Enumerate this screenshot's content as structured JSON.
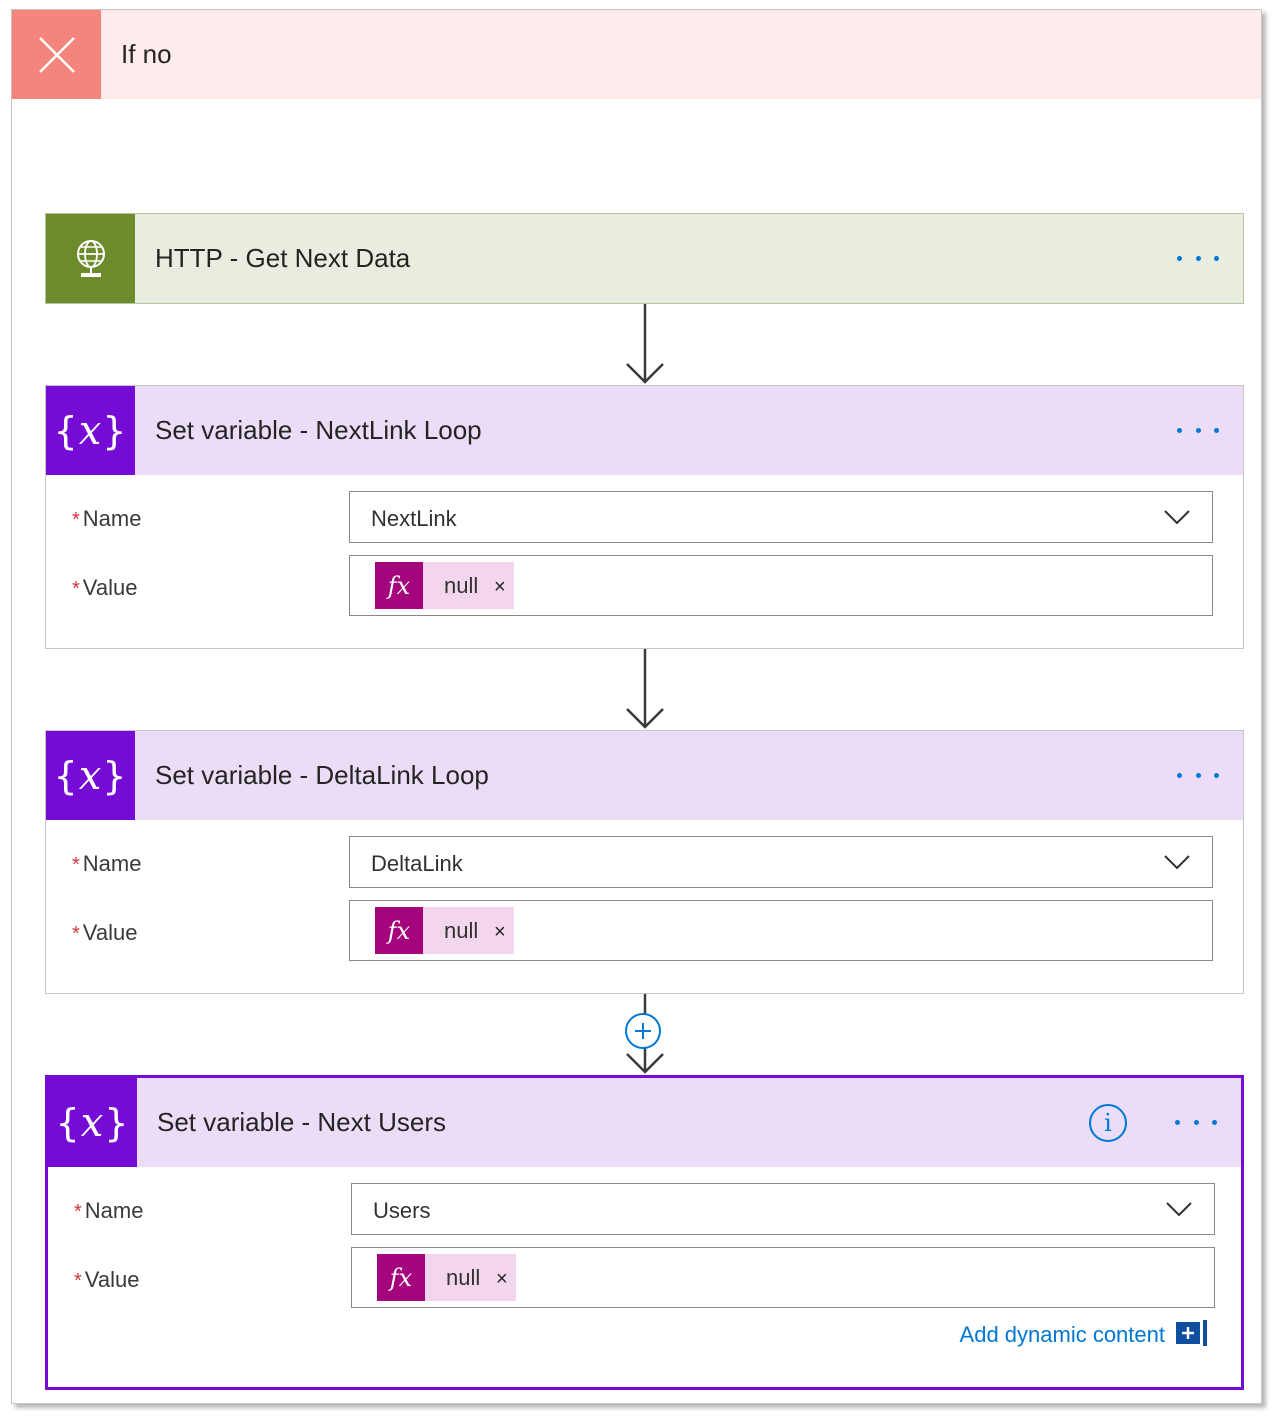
{
  "branch": {
    "title": "If no",
    "icon": "close-icon",
    "color": "#f4857c"
  },
  "actions": [
    {
      "title": "HTTP - Get Next Data",
      "icon": "http-globe-icon",
      "color": "#6d8b2d"
    },
    {
      "title": "Set variable - NextLink Loop",
      "icon": "variable-icon",
      "color": "#770bd6",
      "name_label": "Name",
      "name_value": "NextLink",
      "value_label": "Value",
      "value_token": "null"
    },
    {
      "title": "Set variable - DeltaLink Loop",
      "icon": "variable-icon",
      "color": "#770bd6",
      "name_label": "Name",
      "name_value": "DeltaLink",
      "value_label": "Value",
      "value_token": "null"
    },
    {
      "title": "Set variable - Next Users",
      "icon": "variable-icon",
      "color": "#770bd6",
      "name_label": "Name",
      "name_value": "Users",
      "value_label": "Value",
      "value_token": "null",
      "add_dynamic_label": "Add dynamic content"
    }
  ],
  "required_marker": "*",
  "fx_label": "fx",
  "token_remove": "×",
  "icon_text": {
    "brace_open": "{",
    "var_x": "x",
    "brace_close": "}",
    "info": "i"
  }
}
